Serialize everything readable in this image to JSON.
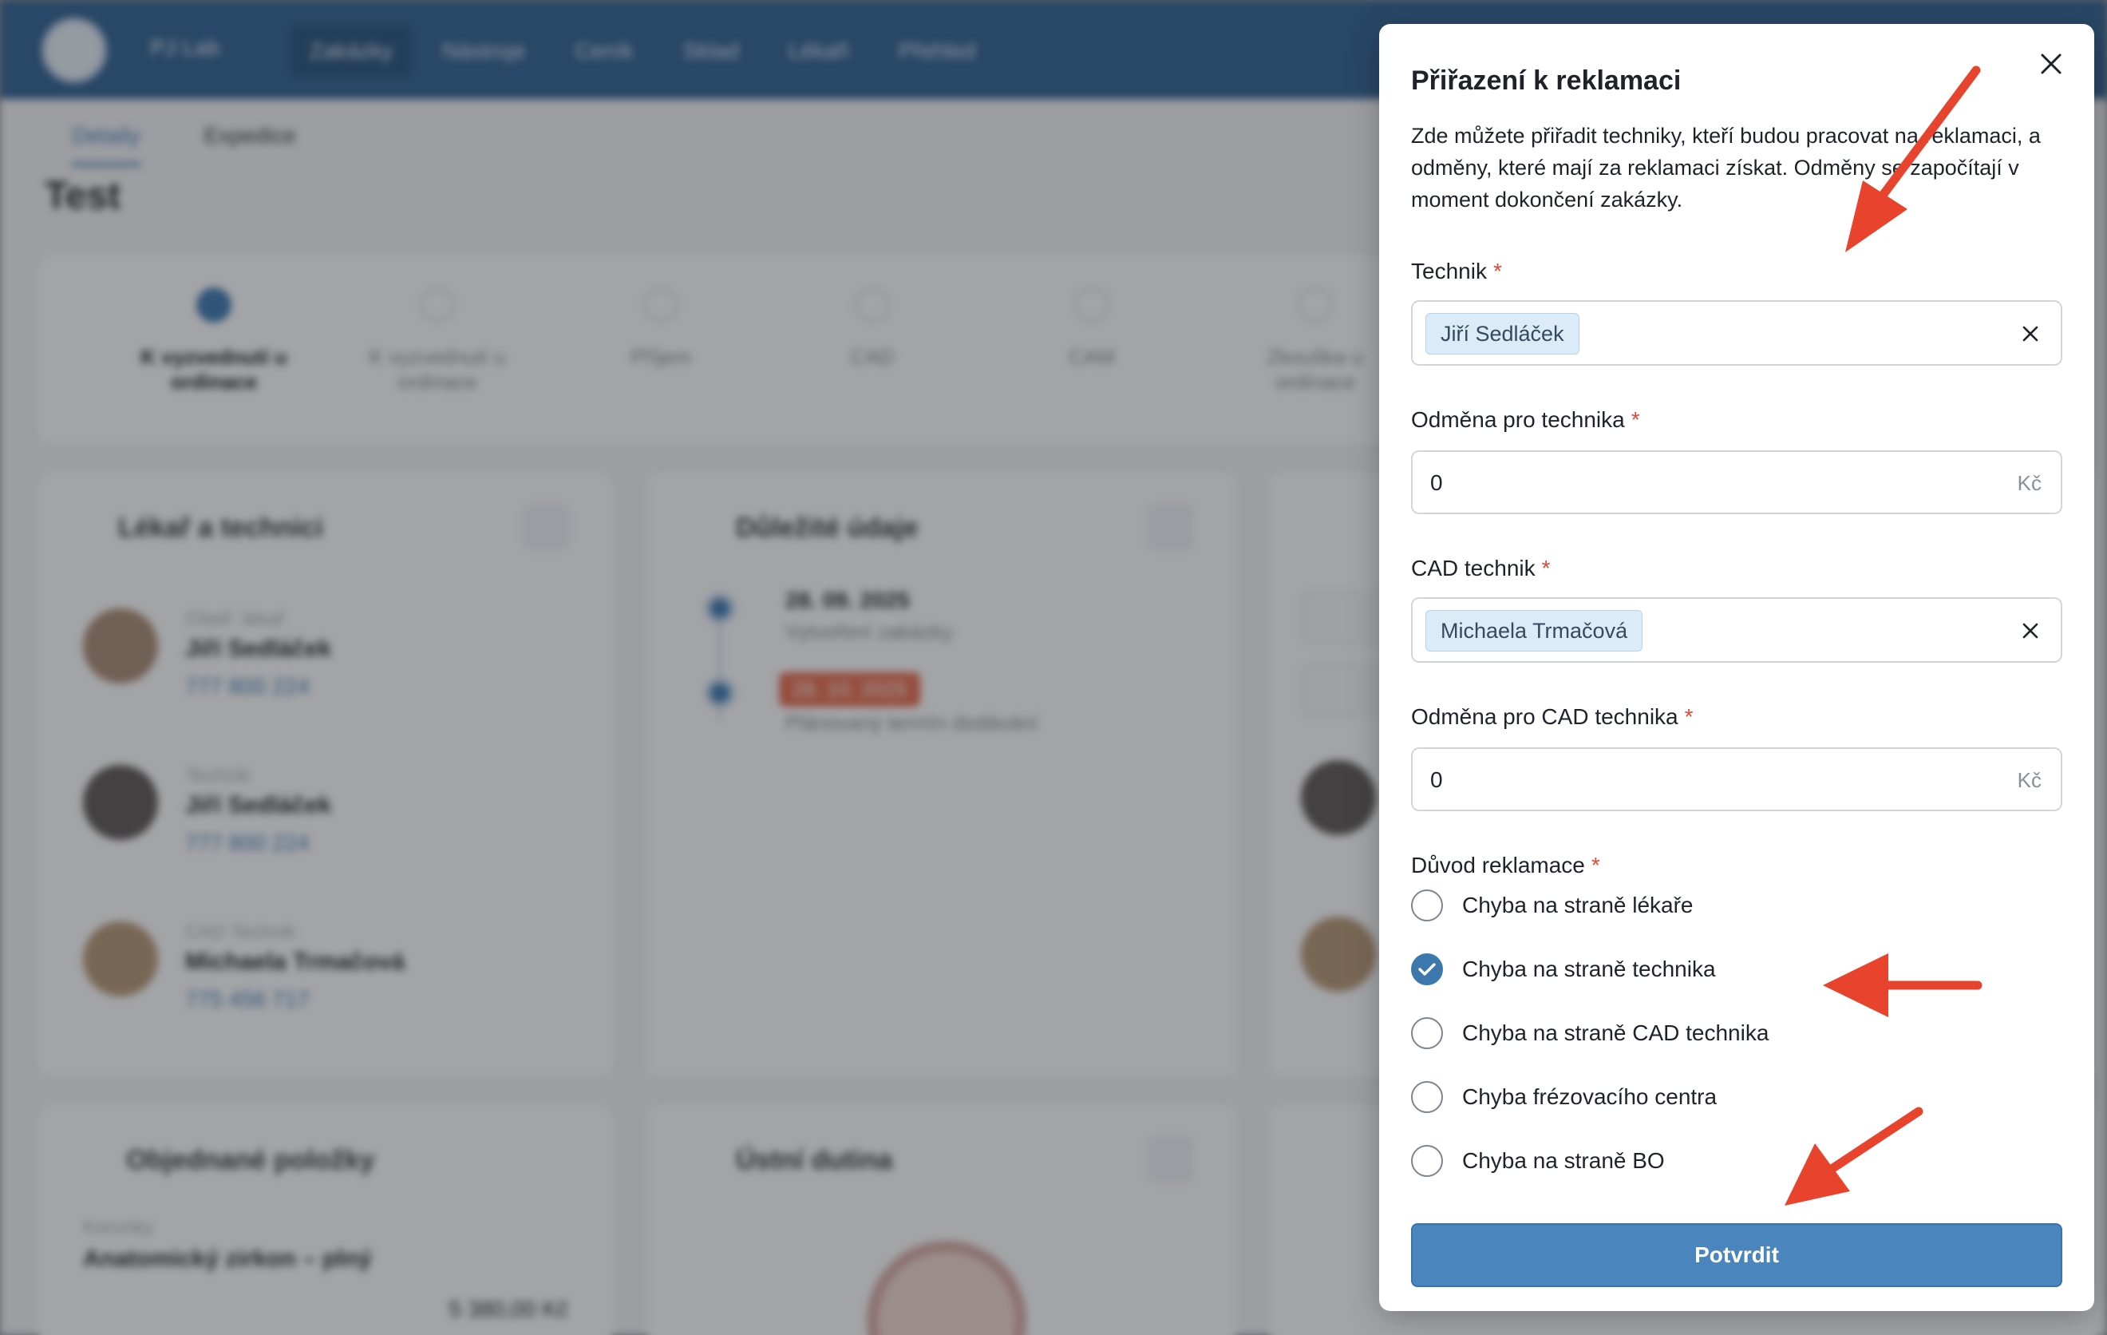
{
  "background": {
    "brand": "PJ Lab",
    "nav": [
      "Zakázky",
      "Nástroje",
      "Ceník",
      "Sklad",
      "Lékaři",
      "Přehled"
    ],
    "subnav": [
      "Detaily",
      "Expedice"
    ],
    "page_title": "Test",
    "steps": [
      "K vyzvednutí u ordinace",
      "K vyzvednutí u ordinace",
      "Příjem",
      "CAD",
      "CAM",
      "Zkouška u ordinace"
    ],
    "card_doctors_title": "Lékař a technici",
    "persons": [
      {
        "role": "Ošetř. lékař",
        "name": "Jiří Sedláček",
        "phone": "777 800 224"
      },
      {
        "role": "Technik",
        "name": "Jiří Sedláček",
        "phone": "777 800 224"
      },
      {
        "role": "CAD Technik",
        "name": "Michaela Trmačová",
        "phone": "775 456 717"
      }
    ],
    "card_timeline_title": "Důležité údaje",
    "timeline_date": "28. 09. 2025",
    "timeline_text_1": "Vytvoření zakázky",
    "timeline_badge": "28. 10. 2025",
    "timeline_text_2": "Plánovaný termín dodávání",
    "card_items_title": "Objednané položky",
    "item_category": "Korunky",
    "item_name": "Anatomický zirkon – plný",
    "item_price": "5 380,00 Kč",
    "card_mouth_title": "Ústní dutina"
  },
  "modal": {
    "title": "Přiřazení k reklamaci",
    "description": "Zde můžete přiřadit techniky, kteří budou pracovat na reklamaci, a odměny, které mají za reklamaci získat. Odměny se započítají v moment dokončení zakázky.",
    "technik_label": "Technik",
    "technik_value": "Jiří Sedláček",
    "odmena_technik_label": "Odměna pro technika",
    "odmena_technik_value": "0",
    "cad_label": "CAD technik",
    "cad_value": "Michaela Trmačová",
    "odmena_cad_label": "Odměna pro CAD technika",
    "odmena_cad_value": "0",
    "currency": "Kč",
    "required_mark": "*",
    "reason_label": "Důvod reklamace",
    "reasons": [
      {
        "label": "Chyba na straně lékaře",
        "checked": false
      },
      {
        "label": "Chyba na straně technika",
        "checked": true
      },
      {
        "label": "Chyba na straně CAD technika",
        "checked": false
      },
      {
        "label": "Chyba frézovacího centra",
        "checked": false
      },
      {
        "label": "Chyba na straně BO",
        "checked": false
      }
    ],
    "confirm_label": "Potvrdit"
  },
  "colors": {
    "primary": "#4a86bd",
    "header": "#2d5f8f",
    "required": "#e0483a",
    "arrow": "#e8432c"
  }
}
